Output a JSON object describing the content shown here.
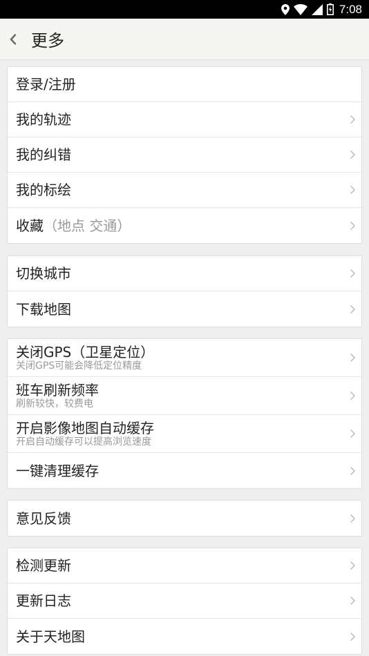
{
  "status_bar": {
    "time": "7:08",
    "icons": [
      "location-icon",
      "wifi-icon",
      "signal-icon",
      "battery-icon"
    ]
  },
  "header": {
    "title": "更多",
    "back_icon": "chevron-left-icon"
  },
  "groups": [
    {
      "items": [
        {
          "title": "登录/注册",
          "hint": "",
          "subtitle": "",
          "has_chevron": false
        },
        {
          "title": "我的轨迹",
          "hint": "",
          "subtitle": "",
          "has_chevron": true
        },
        {
          "title": "我的纠错",
          "hint": "",
          "subtitle": "",
          "has_chevron": true
        },
        {
          "title": "我的标绘",
          "hint": "",
          "subtitle": "",
          "has_chevron": true
        },
        {
          "title": "收藏",
          "hint": "（地点 交通）",
          "subtitle": "",
          "has_chevron": true
        }
      ]
    },
    {
      "items": [
        {
          "title": "切换城市",
          "subtitle": "",
          "has_chevron": true
        },
        {
          "title": "下载地图",
          "subtitle": "",
          "has_chevron": true
        }
      ]
    },
    {
      "items": [
        {
          "title": "关闭GPS（卫星定位）",
          "subtitle": "关闭GPS可能会降低定位精度",
          "has_chevron": true
        },
        {
          "title": "班车刷新频率",
          "subtitle": "刷新较快，较费电",
          "has_chevron": true
        },
        {
          "title": "开启影像地图自动缓存",
          "subtitle": "开启自动缓存可以提高浏览速度",
          "has_chevron": true
        },
        {
          "title": "一键清理缓存",
          "subtitle": "",
          "has_chevron": true
        }
      ]
    },
    {
      "items": [
        {
          "title": "意见反馈",
          "subtitle": "",
          "has_chevron": true
        }
      ]
    },
    {
      "items": [
        {
          "title": "检测更新",
          "subtitle": "",
          "has_chevron": true
        },
        {
          "title": "更新日志",
          "subtitle": "",
          "has_chevron": true
        },
        {
          "title": "关于天地图",
          "subtitle": "",
          "has_chevron": true
        }
      ]
    }
  ]
}
